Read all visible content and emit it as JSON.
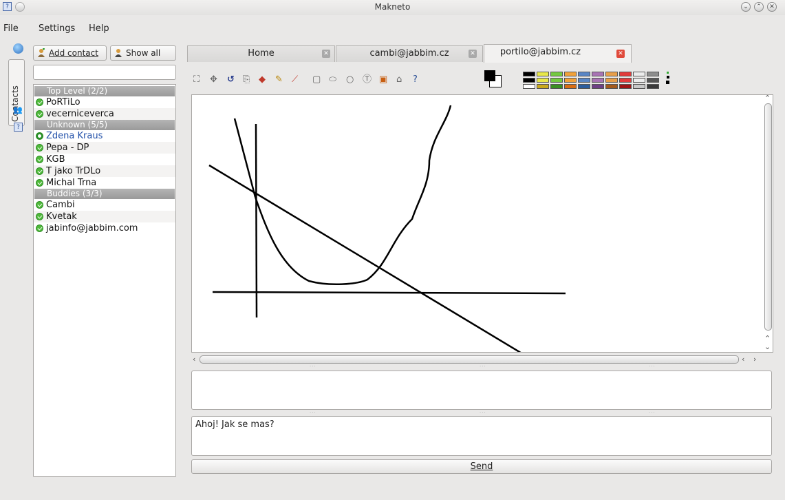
{
  "window": {
    "title": "Makneto"
  },
  "menu": {
    "file": "File",
    "settings": "Settings",
    "help": "Help"
  },
  "sidebar": {
    "contacts_tab": "Contacts"
  },
  "contacts": {
    "add_contact": "Add contact",
    "show_all": "Show all",
    "search_value": "",
    "groups": [
      {
        "name": "Top Level (2/2)",
        "items": [
          "PoRTiLo",
          "vecerniceverca"
        ]
      },
      {
        "name": "Unknown (5/5)",
        "items": [
          "Zdena Kraus",
          "Pepa - DP",
          "KGB",
          "T jako TrDLo",
          "Michal Trna"
        ]
      },
      {
        "name": "Buddies (3/3)",
        "items": [
          "Cambi",
          "Kvetak",
          "jabinfo@jabbim.com"
        ]
      }
    ]
  },
  "tabs": [
    {
      "label": "Home"
    },
    {
      "label": "cambi@jabbim.cz"
    },
    {
      "label": "portilo@jabbim.cz",
      "active": true
    }
  ],
  "toolbar": {
    "tools": [
      "select-icon",
      "move-icon",
      "undo-icon",
      "clear-icon",
      "eraser-icon",
      "pencil-icon",
      "line-icon",
      "rectangle-icon",
      "ellipse-icon",
      "circle-icon",
      "text-icon",
      "image-icon",
      "picture-icon",
      "help-icon"
    ],
    "foreground": "#000000",
    "background": "#ffffff"
  },
  "palette": {
    "top": [
      "#000000",
      "#e8e84a",
      "#74c93f",
      "#f0a13a",
      "#5a86c5",
      "#a873b4",
      "#e79f4a",
      "#e23b3b",
      "#ececec",
      "#8d8d8d"
    ],
    "bottom": [
      "#ffffff",
      "#c9a91c",
      "#3b8f22",
      "#d86d14",
      "#2c5d9e",
      "#6e3f86",
      "#a35a1c",
      "#9e1414",
      "#c8c8c8",
      "#3a3a3a"
    ]
  },
  "chat": {
    "log": "",
    "message": "Ahoj! Jak se mas?",
    "send": "Send"
  }
}
